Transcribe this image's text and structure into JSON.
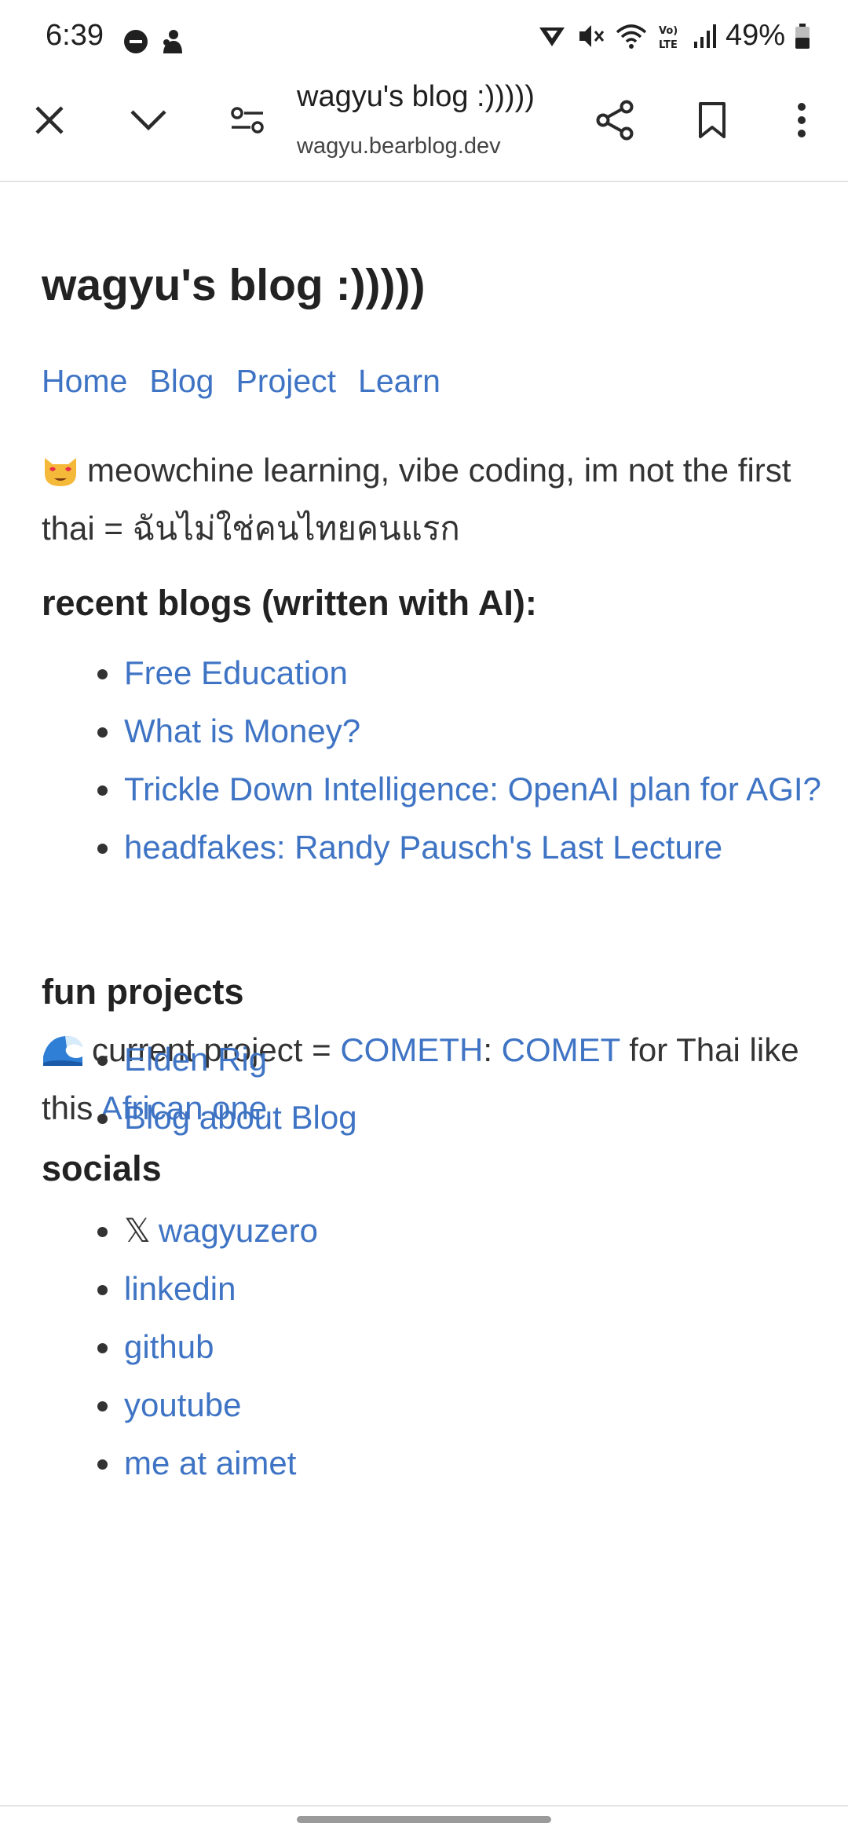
{
  "status_bar": {
    "time": "6:39",
    "battery": "49%",
    "icons": [
      "do-not-disturb-icon",
      "notification-icon",
      "vpn-icon",
      "mute-icon",
      "wifi-icon",
      "volte-icon",
      "signal-icon",
      "battery-icon"
    ]
  },
  "toolbar": {
    "page_title": "wagyu's blog :)))))",
    "url": "wagyu.bearblog.dev",
    "icons": [
      "close-icon",
      "chevron-down-icon",
      "site-settings-icon",
      "share-icon",
      "bookmark-icon",
      "more-icon"
    ]
  },
  "page": {
    "title": "wagyu's blog :)))))",
    "nav": [
      "Home",
      "Blog",
      "Project",
      "Learn"
    ],
    "intro": "meowchine learning, vibe coding, im not the first thai = ฉันไม่ใช่คนไทยคนแรก",
    "recent_heading": "recent blogs (written with AI):",
    "recent_blogs": [
      "Free Education",
      "What is Money?",
      "Trickle Down Intelligence: OpenAI plan for AGI?",
      "headfakes: Randy Pausch's Last Lecture"
    ],
    "project_prefix": "current project = ",
    "project_link1": "COMETH",
    "project_colon": ": ",
    "project_link2": "COMET",
    "project_mid": " for Thai like this ",
    "project_link3": "African one",
    "fun_heading": "fun projects",
    "fun_projects": [
      "Elden Rig",
      "Blog about Blog"
    ],
    "socials_heading": "socials",
    "x_symbol": "𝕏",
    "socials": [
      "wagyuzero",
      "linkedin",
      "github",
      "youtube",
      "me at aimet"
    ]
  },
  "colors": {
    "link": "#3f74c4",
    "text": "#333333",
    "heading": "#222222"
  }
}
